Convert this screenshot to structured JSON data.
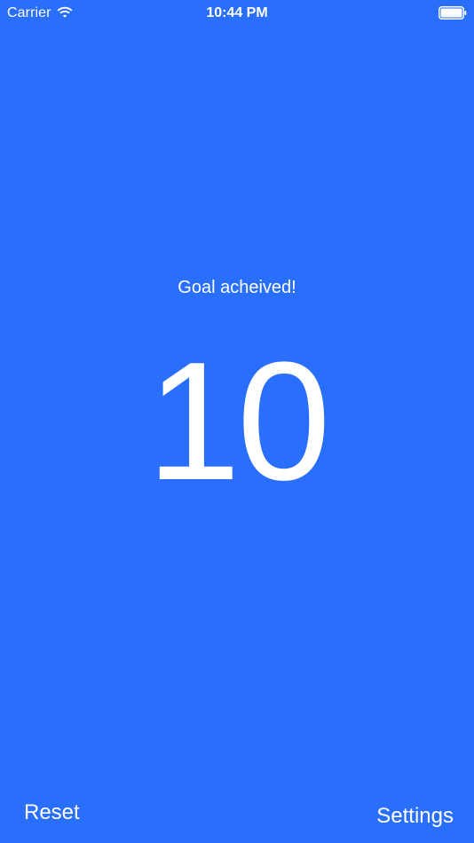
{
  "status_bar": {
    "carrier": "Carrier",
    "time": "10:44 PM",
    "wifi_icon": "wifi-icon",
    "battery_icon": "battery-icon"
  },
  "main": {
    "message": "Goal acheived!",
    "count": "10"
  },
  "footer": {
    "reset_label": "Reset",
    "settings_label": "Settings"
  },
  "colors": {
    "background": "#2a6efc",
    "text": "#ffffff"
  }
}
